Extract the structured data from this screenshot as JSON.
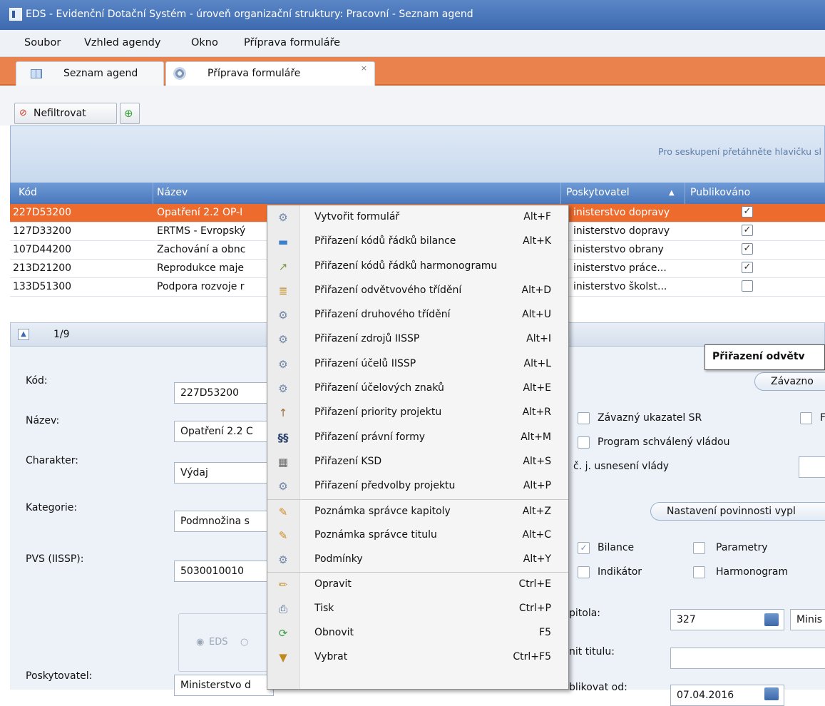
{
  "window": {
    "title": "EDS - Evidenční Dotační Systém - úroveň organizační struktury: Pracovní - Seznam agend"
  },
  "menu": [
    "Soubor",
    "Vzhled agendy",
    "Okno",
    "Příprava formuláře"
  ],
  "tabs": [
    {
      "label": "Seznam agend",
      "icon": "grid-icon"
    },
    {
      "label": "Příprava formuláře",
      "icon": "gear-icon",
      "close": "×"
    }
  ],
  "toolbar": {
    "filter_label": "Nefiltrovat"
  },
  "grid": {
    "group_hint": "Pro seskupení přetáhněte hlavičku sl",
    "columns": {
      "kod": "Kód",
      "nazev": "Název",
      "poskytovatel": "Poskytovatel",
      "sort_arrow": "▲",
      "publikovano": "Publikováno"
    },
    "rows": [
      {
        "kod": "227D53200",
        "nazev": "Opatření 2.2 OP-I",
        "poskytovatel": "inisterstvo dopravy",
        "checked": true
      },
      {
        "kod": "127D33200",
        "nazev": "ERTMS - Evropský",
        "poskytovatel": "inisterstvo dopravy",
        "checked": true
      },
      {
        "kod": "107D44200",
        "nazev": "Zachování a obnc",
        "poskytovatel": "inisterstvo obrany",
        "checked": true
      },
      {
        "kod": "213D21200",
        "nazev": "Reprodukce maje",
        "poskytovatel": "inisterstvo práce...",
        "checked": true
      },
      {
        "kod": "133D51300",
        "nazev": "Podpora rozvoje r",
        "poskytovatel": "inisterstvo školst...",
        "checked": false
      }
    ],
    "pager": "1/9",
    "check_mark": "✓"
  },
  "detail": {
    "kod_label": "Kód:",
    "kod_value": "227D53200",
    "nazev_label": "Název:",
    "nazev_value": "Opatření 2.2 C",
    "charakter_label": "Charakter:",
    "charakter_value": "Výdaj",
    "kategorie_label": "Kategorie:",
    "kategorie_value": "Podmnožina s",
    "pvs_label": "PVS (IISSP):",
    "pvs_value": "5030010010",
    "poskytovatel_label": "Poskytovatel:",
    "poskytovatel_value": "Ministerstvo d",
    "radio_eds": "EDS",
    "popup_title": "Přiřazení odvětv",
    "zavazno_button": "Závazno",
    "zavazny_ukazatel": "Závazný ukazatel SR",
    "right_cut_letter": "F",
    "program_schvaleny": "Program schválený vládou",
    "cj_usneseni": "č. j. usnesení vlády",
    "nastaveni_button": "Nastavení povinnosti vypl",
    "bilance": "Bilance",
    "parametry": "Parametry",
    "indikator": "Indikátor",
    "harmonogram": "Harmonogram",
    "kapitola_label": "pitola:",
    "kapitola_value": "327",
    "kapitola_name": "Minis",
    "limit_titulu_label": "nit titulu:",
    "publikovat_label": "blikovat od:",
    "publikovat_value": "07.04.2016"
  },
  "context_menu": [
    {
      "label": "Vytvořit formulář",
      "shortcut": "Alt+F",
      "icon": "gear-icon"
    },
    {
      "label": "Přiřazení kódů řádků bilance",
      "shortcut": "Alt+K",
      "icon": "bars-icon"
    },
    {
      "label": "Přiřazení kódů řádků harmonogramu",
      "shortcut": "",
      "icon": "chart-icon"
    },
    {
      "label": "Přiřazení odvětvového třídění",
      "shortcut": "Alt+D",
      "icon": "list-icon"
    },
    {
      "label": "Přiřazení druhového třídění",
      "shortcut": "Alt+U",
      "icon": "gear-icon"
    },
    {
      "label": "Přiřazení zdrojů IISSP",
      "shortcut": "Alt+I",
      "icon": "gear-icon"
    },
    {
      "label": "Přiřazení účelů IISSP",
      "shortcut": "Alt+L",
      "icon": "gear-icon"
    },
    {
      "label": "Přiřazení účelových znaků",
      "shortcut": "Alt+E",
      "icon": "gear-icon"
    },
    {
      "label": "Přiřazení priority projektu",
      "shortcut": "Alt+R",
      "icon": "priority-icon"
    },
    {
      "label": "Přiřazení právní formy",
      "shortcut": "Alt+M",
      "icon": "paragraph-icon"
    },
    {
      "label": "Přiřazení KSD",
      "shortcut": "Alt+S",
      "icon": "ksd-icon"
    },
    {
      "label": "Přiřazení předvolby projektu",
      "shortcut": "Alt+P",
      "icon": "gear-icon"
    },
    {
      "label": "Poznámka správce kapitoly",
      "shortcut": "Alt+Z",
      "icon": "note-icon"
    },
    {
      "label": "Poznámka správce titulu",
      "shortcut": "Alt+C",
      "icon": "note-icon"
    },
    {
      "label": "Podmínky",
      "shortcut": "Alt+Y",
      "icon": "gear-icon"
    },
    {
      "label": "Opravit",
      "shortcut": "Ctrl+E",
      "icon": "pencil-icon"
    },
    {
      "label": "Tisk",
      "shortcut": "Ctrl+P",
      "icon": "printer-icon"
    },
    {
      "label": "Obnovit",
      "shortcut": "F5",
      "icon": "refresh-icon"
    },
    {
      "label": "Vybrat",
      "shortcut": "Ctrl+F5",
      "icon": "funnel-icon"
    }
  ]
}
